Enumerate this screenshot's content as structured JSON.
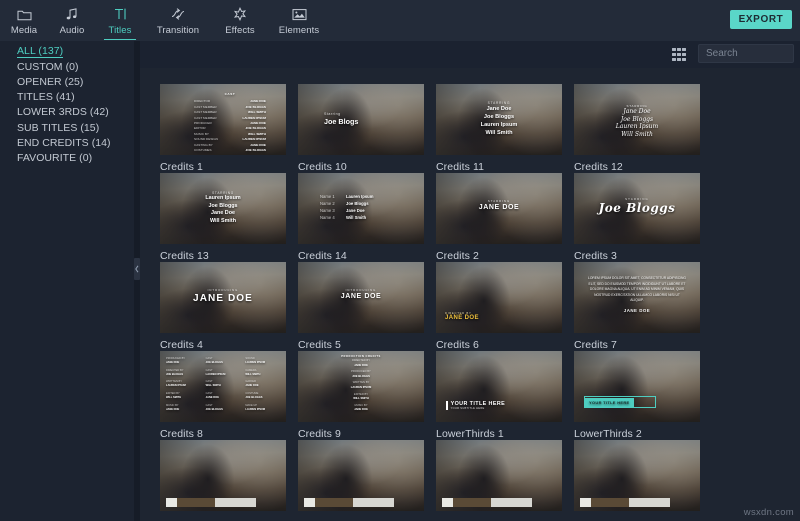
{
  "toolbar": {
    "tabs": [
      {
        "label": "Media",
        "icon": "folder-icon",
        "active": false
      },
      {
        "label": "Audio",
        "icon": "music-note-icon",
        "active": false
      },
      {
        "label": "Titles",
        "icon": "text-tool-icon",
        "active": true
      },
      {
        "label": "Transition",
        "icon": "transition-icon",
        "active": false
      },
      {
        "label": "Effects",
        "icon": "star-burst-icon",
        "active": false
      },
      {
        "label": "Elements",
        "icon": "image-icon",
        "active": false
      }
    ],
    "export_label": "EXPORT",
    "accent_color": "#4ecdc0",
    "export_bg": "#5ad6c8"
  },
  "sidebar": {
    "items": [
      {
        "label": "ALL (137)",
        "active": true
      },
      {
        "label": "CUSTOM (0)",
        "active": false
      },
      {
        "label": "OPENER (25)",
        "active": false
      },
      {
        "label": "TITLES (41)",
        "active": false
      },
      {
        "label": "LOWER 3RDS (42)",
        "active": false
      },
      {
        "label": "SUB TITLES (15)",
        "active": false
      },
      {
        "label": "END CREDITS (14)",
        "active": false
      },
      {
        "label": "FAVOURITE (0)",
        "active": false
      }
    ]
  },
  "search": {
    "placeholder": "Search",
    "value": "",
    "icon": "magnifier-icon",
    "grid_icon": "grid-view-icon"
  },
  "grid": {
    "items": [
      {
        "caption": "Credits 1",
        "style": "rolllist",
        "head": "CAST",
        "rows": [
          {
            "k": "DIRECTOR",
            "v": "JANE DOE"
          },
          {
            "k": "CAST MEMBER",
            "v": "JOE BLOGGS"
          },
          {
            "k": "CAST MEMBER",
            "v": "WILL SMITH"
          },
          {
            "k": "CAST MEMBER",
            "v": "LAUREN IPSUM"
          },
          {
            "k": "PRODUCER",
            "v": "JANE DOE"
          },
          {
            "k": "EDITOR",
            "v": "JOE BLOGGS"
          },
          {
            "k": "MUSIC BY",
            "v": "WILL SMITH"
          },
          {
            "k": "SOUND DESIGN",
            "v": "LAUREN IPSUM"
          },
          {
            "k": "CASTING BY",
            "v": "JANE DOE"
          },
          {
            "k": "COSTUMES",
            "v": "JOE BLOGGS"
          }
        ]
      },
      {
        "caption": "Credits 10",
        "style": "starring",
        "small": "Starring",
        "big": "Joe Blogs"
      },
      {
        "caption": "Credits 11",
        "style": "centerlist",
        "small": "STARRING",
        "names": [
          "Jane Doe",
          "Joe Bloggs",
          "Lauren Ipsum",
          "Will Smith"
        ]
      },
      {
        "caption": "Credits 12",
        "style": "script",
        "small": "STARRING",
        "names": [
          "Jane Doe",
          "Joe Bloggs",
          "Lauren Ipsum",
          "Will Smith"
        ]
      },
      {
        "caption": "Credits 13",
        "style": "rightlist",
        "small": "STARRING",
        "names": [
          "Lauren Ipsum",
          "Joe Bloggs",
          "Jane Doe",
          "Will Smith"
        ]
      },
      {
        "caption": "Credits 14",
        "style": "labeled",
        "rows": [
          {
            "k": "Name 1",
            "v": "Lauren Ipsum"
          },
          {
            "k": "Name 2",
            "v": "Joe Bloggs"
          },
          {
            "k": "Name 3",
            "v": "Jane Doe"
          },
          {
            "k": "Name 4",
            "v": "Will Smith"
          }
        ]
      },
      {
        "caption": "Credits 2",
        "style": "name",
        "small": "STARRING",
        "n": "JANE DOE",
        "large": false
      },
      {
        "caption": "Credits 3",
        "style": "cursive",
        "small": "STARRING",
        "n": "Joe Bloggs"
      },
      {
        "caption": "Credits 4",
        "style": "name",
        "small": "INTRODUCING",
        "n": "JANE DOE",
        "large": true
      },
      {
        "caption": "Credits 5",
        "style": "name",
        "small": "INTRODUCING",
        "n": "JANE DOE",
        "large": false
      },
      {
        "caption": "Credits 6",
        "style": "corner",
        "small": "DIRECTED BY",
        "n": "JANE DOE"
      },
      {
        "caption": "Credits 7",
        "style": "para",
        "text": "LOREM IPSUM DOLOR SIT AMET, CONSECTETUR ADIPISCING ELIT, SED DO EIUSMOD TEMPOR INCIDIDUNT UT LABORE ET DOLORE MAGNA ALIQUA. UT ENIM AD MINIM VENIAM, QUIS NOSTRUD EXERCITATION ULLAMCO LABORIS NISI UT ALIQUIP.",
        "sig": "JANE DOE"
      },
      {
        "caption": "Credits 8",
        "style": "threecol",
        "columns": [
          [
            {
              "k": "PRODUCED BY",
              "v": "JANE DOE"
            },
            {
              "k": "DIRECTED BY",
              "v": "JOE BLOGGS"
            },
            {
              "k": "WRITTEN BY",
              "v": "LAUREN IPSUM"
            },
            {
              "k": "EDITED BY",
              "v": "WILL SMITH"
            },
            {
              "k": "MUSIC BY",
              "v": "JANE DOE"
            }
          ],
          [
            {
              "k": "CAST",
              "v": "JOE BLOGGS"
            },
            {
              "k": "CAST",
              "v": "LAUREN IPSUM"
            },
            {
              "k": "CAST",
              "v": "WILL SMITH"
            },
            {
              "k": "CAST",
              "v": "JANE DOE"
            },
            {
              "k": "CAST",
              "v": "JOE BLOGGS"
            }
          ],
          [
            {
              "k": "SOUND",
              "v": "LAUREN IPSUM"
            },
            {
              "k": "CAMERA",
              "v": "WILL SMITH"
            },
            {
              "k": "GAFFER",
              "v": "JANE DOE"
            },
            {
              "k": "COSTUME",
              "v": "JOE BLOGGS"
            },
            {
              "k": "MAKE UP",
              "v": "LAUREN IPSUM"
            }
          ]
        ]
      },
      {
        "caption": "Credits 9",
        "style": "stack",
        "head": "PRODUCTION CREDITS",
        "groups": [
          {
            "k": "DIRECTED BY",
            "v": "JANE DOE"
          },
          {
            "k": "PRODUCED BY",
            "v": "JOE BLOGGS"
          },
          {
            "k": "WRITTEN BY",
            "v": "LAUREN IPSUM"
          },
          {
            "k": "EDITED BY",
            "v": "WILL SMITH"
          },
          {
            "k": "MUSIC BY",
            "v": "JANE DOE"
          }
        ]
      },
      {
        "caption": "LowerThirds 1",
        "style": "lt1",
        "t1": "YOUR TITLE HERE",
        "t2": "YOUR SUBTITLE HERE"
      },
      {
        "caption": "LowerThirds 2",
        "style": "lt2",
        "t1": "YOUR TITLE HERE"
      },
      {
        "caption": "",
        "style": "partial"
      },
      {
        "caption": "",
        "style": "partial"
      },
      {
        "caption": "",
        "style": "partial"
      },
      {
        "caption": "",
        "style": "partial"
      }
    ]
  },
  "watermark": "wsxdn.com"
}
